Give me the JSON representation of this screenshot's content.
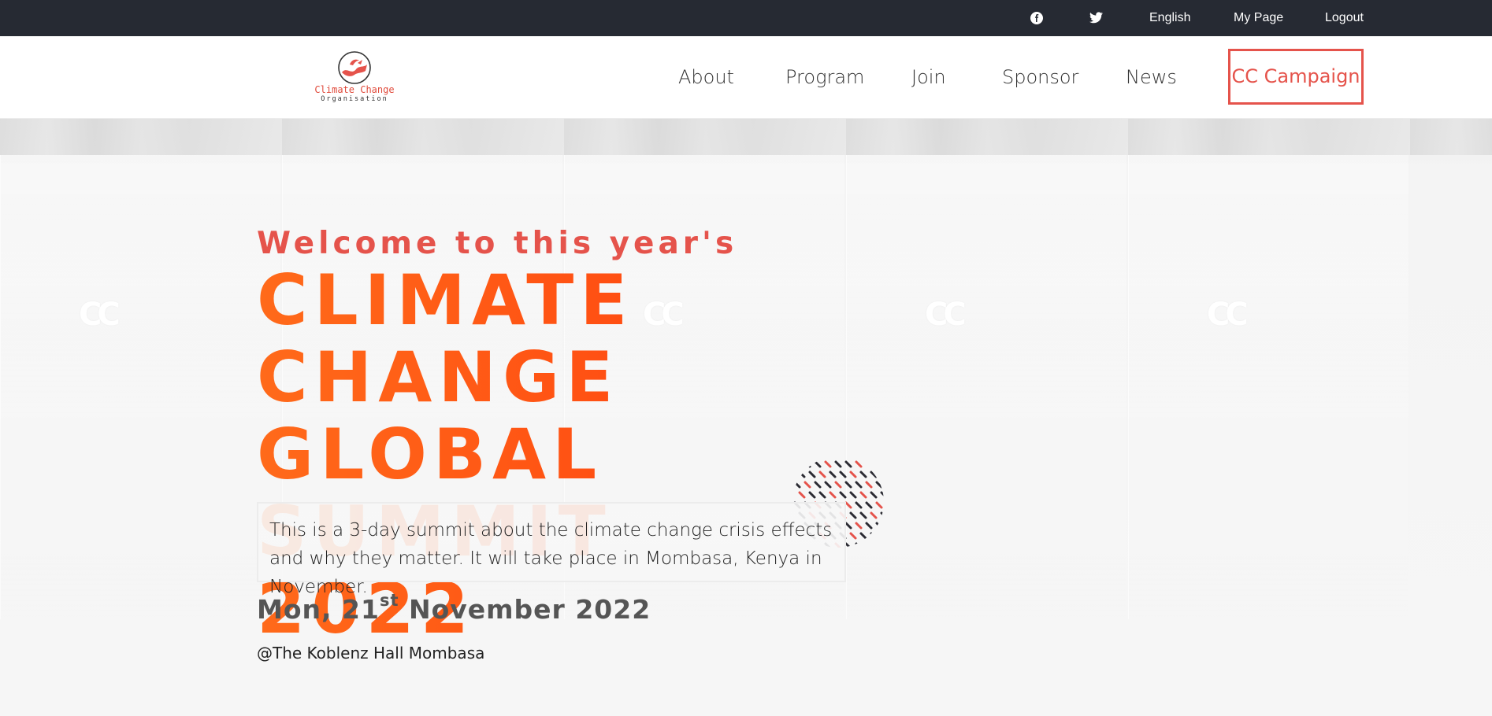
{
  "topbar": {
    "facebook_icon": "facebook-icon",
    "twitter_icon": "twitter-icon",
    "language": "English",
    "my_page": "My Page",
    "logout": "Logout"
  },
  "nav": {
    "logo_text": "Climate Change",
    "logo_subtext": "Organisation",
    "links": [
      "About",
      "Program",
      "Join",
      "Sponsor",
      "News"
    ],
    "cta": "CC Campaign"
  },
  "hero": {
    "welcome": "Welcome to this year's",
    "headline_line1": "CLIMATE CHANGE",
    "headline_line2": "GLOBAL SUMMIT",
    "headline_line3": "2022",
    "description": "This is a 3-day summit about the climate change crisis effects and why they matter. It will take place in Mombasa, Kenya in November.",
    "date_prefix": "Mon, 21",
    "date_suffix": "st",
    "date_rest": " November 2022",
    "venue": "@The Koblenz Hall Mombasa",
    "background_mark": "CC"
  },
  "colors": {
    "accent": "#e5534b",
    "headline_orange": "#ff5a14",
    "topbar_bg": "#262a33"
  }
}
